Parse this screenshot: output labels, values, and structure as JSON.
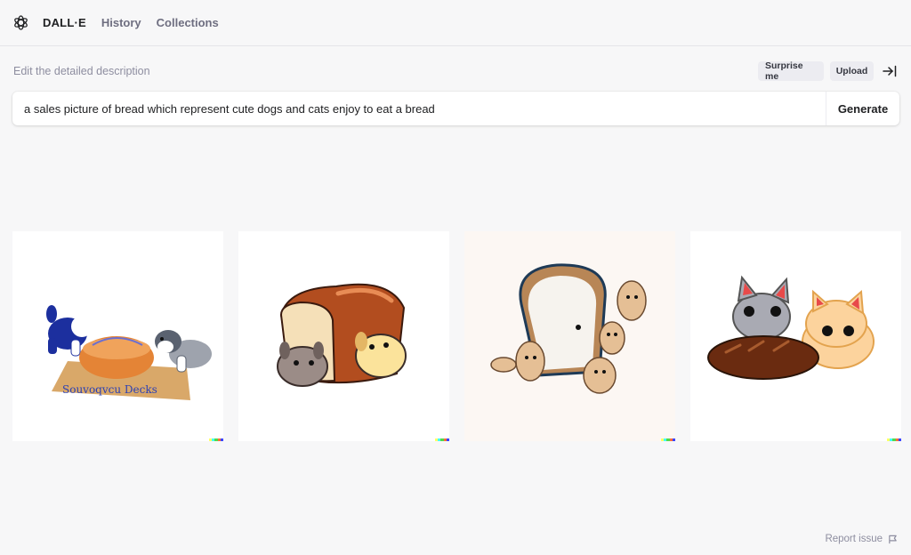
{
  "nav": {
    "brand": "DALL·E",
    "history": "History",
    "collections": "Collections"
  },
  "editor": {
    "label": "Edit the detailed description",
    "surprise_label": "Surprise me",
    "upload_label": "Upload",
    "prompt_value": "a sales picture of bread which represent cute dogs and cats enjoy to eat a bread",
    "generate_label": "Generate"
  },
  "results": {
    "images": [
      {
        "subject": "puppies beside bread loaf on placemat",
        "caption_text": "Souvoqvcu Decks"
      },
      {
        "subject": "puppies in front of bread loaf"
      },
      {
        "subject": "bread slice with beige cats"
      },
      {
        "subject": "two kittens with baguette"
      }
    ],
    "signature_colors": [
      "#ffff66",
      "#42ffff",
      "#51da4c",
      "#ff6e3c",
      "#3c46ff"
    ]
  },
  "footer": {
    "report_label": "Report issue"
  }
}
